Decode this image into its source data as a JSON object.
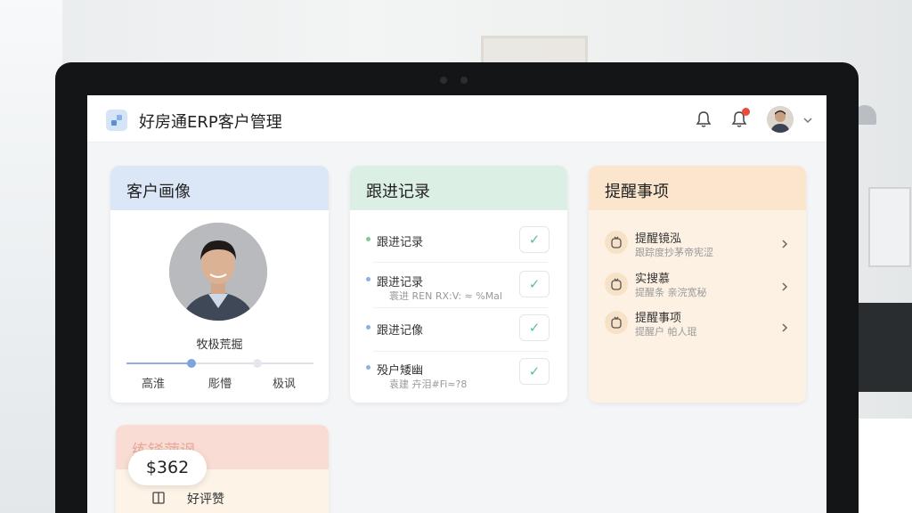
{
  "header": {
    "app_title": "好房通ERP客户管理",
    "icons": [
      "bell-icon",
      "bell-icon-with-badge",
      "avatar",
      "chevron-down-icon"
    ],
    "badge_color": "#e74c3c"
  },
  "profile_card": {
    "title": "客户画像",
    "name": "牧极荒掘",
    "stages": [
      "高淮",
      "彫懵",
      "极讽"
    ],
    "progress_fraction": 0.35,
    "header_color": "#dbe7f7"
  },
  "followup_card": {
    "title": "跟进记录",
    "header_color": "#dcefe4",
    "items": [
      {
        "title": "跟进记录",
        "sub": "",
        "bullet_color": "#7dc9a0"
      },
      {
        "title": "跟进记录",
        "sub": "寰进 REN RX:V: ≈ %Mal",
        "bullet_color": "#8db0de"
      },
      {
        "title": "跟进记像",
        "sub": "",
        "bullet_color": "#8db0de"
      },
      {
        "title": "殁户矮幽",
        "sub": "袁建 卉泪#Fi≈?8",
        "bullet_color": "#8db0de"
      }
    ],
    "check_glyph": "✓"
  },
  "reminder_card": {
    "title": "提醒事项",
    "header_color": "#fbe6cd",
    "items": [
      {
        "title": "提醒镜泓",
        "sub": "跟踪度抄茅帝宪涩"
      },
      {
        "title": "实搜慕",
        "sub": "提醒条 亲浣宽秘"
      },
      {
        "title": "提醒事项",
        "sub": "提醒户 帕人琨"
      }
    ]
  },
  "bottom_card": {
    "title": "练铩萍讽",
    "amount": "$362",
    "label": "好评赞",
    "header_color": "#f9dcd3"
  }
}
